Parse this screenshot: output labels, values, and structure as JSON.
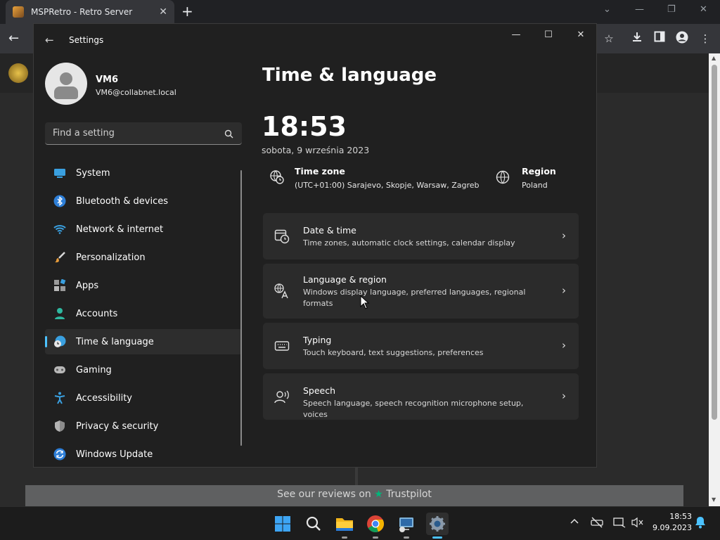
{
  "browser": {
    "tab_title": "MSPRetro - Retro Server",
    "tab_close": "✕",
    "new_tab": "+"
  },
  "footer": {
    "text": "See our reviews on",
    "brand": "Trustpilot"
  },
  "settings": {
    "window_title": "Settings",
    "user": {
      "name": "VM6",
      "email": "VM6@collabnet.local"
    },
    "search_placeholder": "Find a setting",
    "nav": [
      {
        "label": "System",
        "icon": "system-icon"
      },
      {
        "label": "Bluetooth & devices",
        "icon": "bluetooth-icon"
      },
      {
        "label": "Network & internet",
        "icon": "wifi-icon"
      },
      {
        "label": "Personalization",
        "icon": "brush-icon"
      },
      {
        "label": "Apps",
        "icon": "apps-icon"
      },
      {
        "label": "Accounts",
        "icon": "person-icon"
      },
      {
        "label": "Time & language",
        "icon": "globe-clock-icon",
        "active": true
      },
      {
        "label": "Gaming",
        "icon": "gamepad-icon"
      },
      {
        "label": "Accessibility",
        "icon": "accessibility-icon"
      },
      {
        "label": "Privacy & security",
        "icon": "shield-icon"
      },
      {
        "label": "Windows Update",
        "icon": "update-icon"
      }
    ],
    "page_title": "Time & language",
    "clock": "18:53",
    "date": "sobota, 9 września 2023",
    "time_zone": {
      "title": "Time zone",
      "value": "(UTC+01:00) Sarajevo, Skopje, Warsaw, Zagreb"
    },
    "region": {
      "title": "Region",
      "value": "Poland"
    },
    "cards": [
      {
        "title": "Date & time",
        "subtitle": "Time zones, automatic clock settings, calendar display",
        "icon": "calendar-clock-icon"
      },
      {
        "title": "Language & region",
        "subtitle": "Windows display language, preferred languages, regional formats",
        "icon": "language-icon"
      },
      {
        "title": "Typing",
        "subtitle": "Touch keyboard, text suggestions, preferences",
        "icon": "keyboard-icon"
      },
      {
        "title": "Speech",
        "subtitle": "Speech language, speech recognition microphone setup, voices",
        "icon": "speech-icon"
      }
    ]
  },
  "taskbar": {
    "time": "18:53",
    "date": "9.09.2023",
    "apps": [
      "start-icon",
      "search-icon",
      "file-explorer-icon",
      "chrome-icon",
      "remote-desktop-icon",
      "settings-icon"
    ]
  },
  "colors": {
    "accent": "#4cc2ff",
    "window_bg": "#202020",
    "card_bg": "#2b2b2b"
  }
}
